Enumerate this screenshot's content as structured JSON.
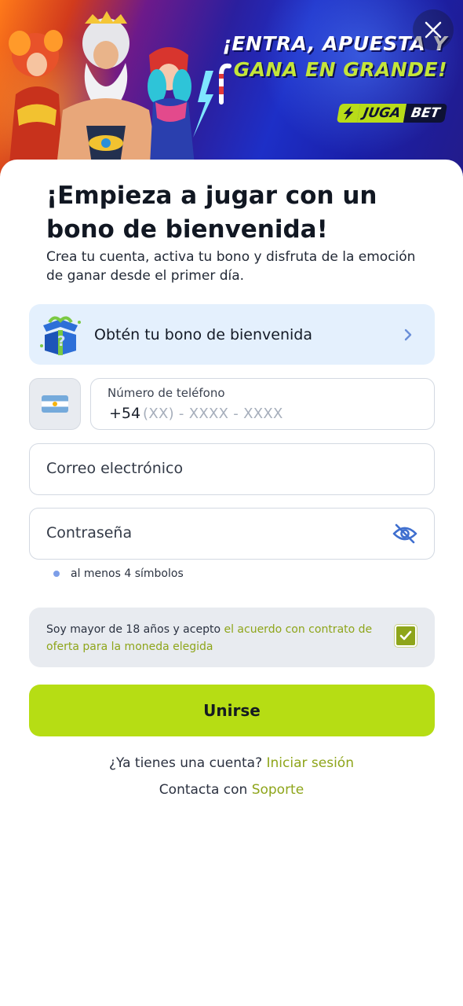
{
  "banner": {
    "headline_line1": "¡ENTRA, APUESTA Y",
    "headline_line2": "GANA EN GRANDE!",
    "brand_part1": "JUGA",
    "brand_part2": "BET",
    "close_icon": "close-icon"
  },
  "form": {
    "title": "¡Empieza a jugar con un bono de bienvenida!",
    "subtitle": "Crea tu cuenta, activa tu bono y disfruta de la emoción de ganar desde el primer día.",
    "bonus_label": "Obtén tu bono de bienvenida",
    "phone": {
      "label": "Número de teléfono",
      "prefix": "+54",
      "placeholder": "(XX) - XXXX - XXXX"
    },
    "email_placeholder": "Correo electrónico",
    "password_placeholder": "Contraseña",
    "password_hint": "al menos 4 símbolos",
    "terms_text": "Soy mayor de 18 años y acepto ",
    "terms_link": "el acuerdo con contrato de oferta para la moneda elegida",
    "terms_checked": true,
    "join_label": "Unirse",
    "login_prompt": "¿Ya tienes una cuenta?",
    "login_link": "Iniciar sesión",
    "support_prompt": "Contacta con",
    "support_link": "Soporte"
  },
  "colors": {
    "accent": "#b6dd14",
    "link": "#8ea51a",
    "bonus_bg": "#e4f0fd",
    "field_border": "#d3d9e2",
    "eye_icon": "#3f6fcf"
  }
}
